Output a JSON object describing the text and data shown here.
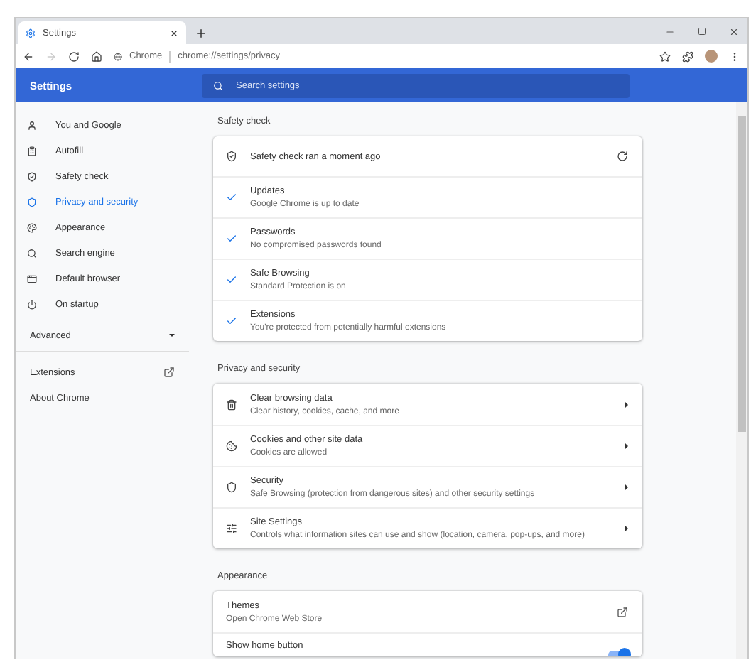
{
  "window": {
    "tab_title": "Settings",
    "site_chip": "Chrome",
    "url": "chrome://settings/privacy",
    "forward_disabled": true
  },
  "header": {
    "title": "Settings",
    "search": {
      "placeholder": "Search settings"
    }
  },
  "sidebar": {
    "items": [
      {
        "label": "You and Google",
        "selected": false
      },
      {
        "label": "Autofill",
        "selected": false
      },
      {
        "label": "Safety check",
        "selected": false
      },
      {
        "label": "Privacy and security",
        "selected": true
      },
      {
        "label": "Appearance",
        "selected": false
      },
      {
        "label": "Search engine",
        "selected": false
      },
      {
        "label": "Default browser",
        "selected": false
      },
      {
        "label": "On startup",
        "selected": false
      }
    ],
    "advanced": {
      "label": "Advanced",
      "expanded": false
    },
    "links": [
      {
        "label": "Extensions",
        "external": true
      },
      {
        "label": "About Chrome",
        "external": false
      }
    ]
  },
  "sections": [
    {
      "title": "Safety check",
      "kind": "safety",
      "status": "Safety check ran a moment ago",
      "items": [
        {
          "title": "Updates",
          "subtitle": "Google Chrome is up to date"
        },
        {
          "title": "Passwords",
          "subtitle": "No compromised passwords found"
        },
        {
          "title": "Safe Browsing",
          "subtitle": "Standard Protection is on"
        },
        {
          "title": "Extensions",
          "subtitle": "You're protected from potentially harmful extensions"
        }
      ]
    },
    {
      "title": "Privacy and security",
      "kind": "nav",
      "items": [
        {
          "title": "Clear browsing data",
          "subtitle": "Clear history, cookies, cache, and more"
        },
        {
          "title": "Cookies and other site data",
          "subtitle": "Cookies are allowed"
        },
        {
          "title": "Security",
          "subtitle": "Safe Browsing (protection from dangerous sites) and other security settings"
        },
        {
          "title": "Site Settings",
          "subtitle": "Controls what information sites can use and show (location, camera, pop-ups, and more)"
        }
      ]
    },
    {
      "title": "Appearance",
      "kind": "appearance",
      "items": [
        {
          "kind": "external",
          "title": "Themes",
          "subtitle": "Open Chrome Web Store"
        },
        {
          "kind": "toggle",
          "title": "Show home button",
          "on": true
        }
      ]
    }
  ]
}
